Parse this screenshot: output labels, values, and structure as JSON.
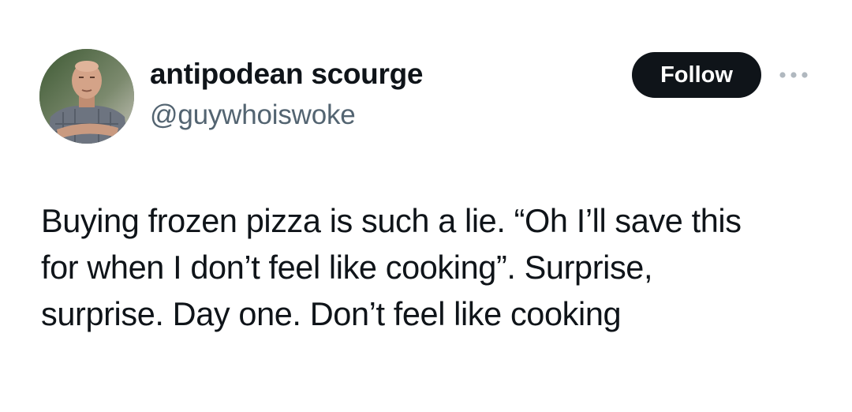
{
  "author": {
    "display_name": "antipodean scourge",
    "handle": "@guywhoiswoke"
  },
  "actions": {
    "follow_label": "Follow",
    "more_icon": "more-horizontal-icon"
  },
  "tweet": {
    "lines": [
      "Buying frozen pizza is such a lie. “Oh I’ll save this",
      "for when I don’t feel like cooking”. Surprise,",
      "surprise. Day one. Don’t feel like cooking"
    ]
  },
  "colors": {
    "text_primary": "#0f1419",
    "text_secondary": "#536471",
    "follow_bg": "#0f1419",
    "follow_text": "#ffffff",
    "more_dots": "#b0b8bf"
  }
}
